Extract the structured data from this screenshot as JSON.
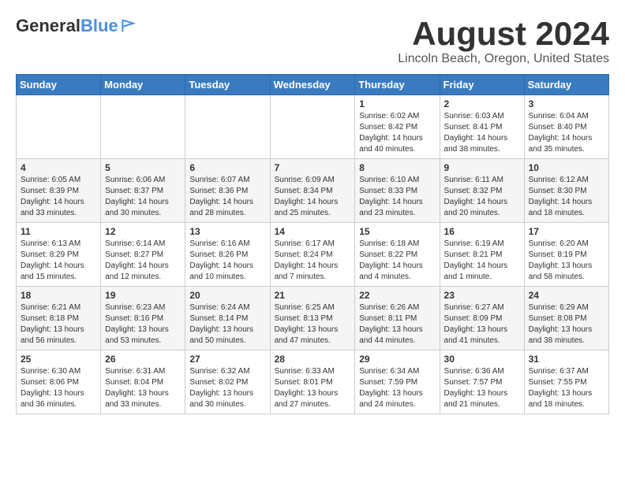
{
  "header": {
    "logo_general": "General",
    "logo_blue": "Blue",
    "title": "August 2024",
    "subtitle": "Lincoln Beach, Oregon, United States"
  },
  "weekdays": [
    "Sunday",
    "Monday",
    "Tuesday",
    "Wednesday",
    "Thursday",
    "Friday",
    "Saturday"
  ],
  "weeks": [
    {
      "days": [
        {
          "num": "",
          "info": ""
        },
        {
          "num": "",
          "info": ""
        },
        {
          "num": "",
          "info": ""
        },
        {
          "num": "",
          "info": ""
        },
        {
          "num": "1",
          "info": "Sunrise: 6:02 AM\nSunset: 8:42 PM\nDaylight: 14 hours\nand 40 minutes."
        },
        {
          "num": "2",
          "info": "Sunrise: 6:03 AM\nSunset: 8:41 PM\nDaylight: 14 hours\nand 38 minutes."
        },
        {
          "num": "3",
          "info": "Sunrise: 6:04 AM\nSunset: 8:40 PM\nDaylight: 14 hours\nand 35 minutes."
        }
      ]
    },
    {
      "days": [
        {
          "num": "4",
          "info": "Sunrise: 6:05 AM\nSunset: 8:39 PM\nDaylight: 14 hours\nand 33 minutes."
        },
        {
          "num": "5",
          "info": "Sunrise: 6:06 AM\nSunset: 8:37 PM\nDaylight: 14 hours\nand 30 minutes."
        },
        {
          "num": "6",
          "info": "Sunrise: 6:07 AM\nSunset: 8:36 PM\nDaylight: 14 hours\nand 28 minutes."
        },
        {
          "num": "7",
          "info": "Sunrise: 6:09 AM\nSunset: 8:34 PM\nDaylight: 14 hours\nand 25 minutes."
        },
        {
          "num": "8",
          "info": "Sunrise: 6:10 AM\nSunset: 8:33 PM\nDaylight: 14 hours\nand 23 minutes."
        },
        {
          "num": "9",
          "info": "Sunrise: 6:11 AM\nSunset: 8:32 PM\nDaylight: 14 hours\nand 20 minutes."
        },
        {
          "num": "10",
          "info": "Sunrise: 6:12 AM\nSunset: 8:30 PM\nDaylight: 14 hours\nand 18 minutes."
        }
      ]
    },
    {
      "days": [
        {
          "num": "11",
          "info": "Sunrise: 6:13 AM\nSunset: 8:29 PM\nDaylight: 14 hours\nand 15 minutes."
        },
        {
          "num": "12",
          "info": "Sunrise: 6:14 AM\nSunset: 8:27 PM\nDaylight: 14 hours\nand 12 minutes."
        },
        {
          "num": "13",
          "info": "Sunrise: 6:16 AM\nSunset: 8:26 PM\nDaylight: 14 hours\nand 10 minutes."
        },
        {
          "num": "14",
          "info": "Sunrise: 6:17 AM\nSunset: 8:24 PM\nDaylight: 14 hours\nand 7 minutes."
        },
        {
          "num": "15",
          "info": "Sunrise: 6:18 AM\nSunset: 8:22 PM\nDaylight: 14 hours\nand 4 minutes."
        },
        {
          "num": "16",
          "info": "Sunrise: 6:19 AM\nSunset: 8:21 PM\nDaylight: 14 hours\nand 1 minute."
        },
        {
          "num": "17",
          "info": "Sunrise: 6:20 AM\nSunset: 8:19 PM\nDaylight: 13 hours\nand 58 minutes."
        }
      ]
    },
    {
      "days": [
        {
          "num": "18",
          "info": "Sunrise: 6:21 AM\nSunset: 8:18 PM\nDaylight: 13 hours\nand 56 minutes."
        },
        {
          "num": "19",
          "info": "Sunrise: 6:23 AM\nSunset: 8:16 PM\nDaylight: 13 hours\nand 53 minutes."
        },
        {
          "num": "20",
          "info": "Sunrise: 6:24 AM\nSunset: 8:14 PM\nDaylight: 13 hours\nand 50 minutes."
        },
        {
          "num": "21",
          "info": "Sunrise: 6:25 AM\nSunset: 8:13 PM\nDaylight: 13 hours\nand 47 minutes."
        },
        {
          "num": "22",
          "info": "Sunrise: 6:26 AM\nSunset: 8:11 PM\nDaylight: 13 hours\nand 44 minutes."
        },
        {
          "num": "23",
          "info": "Sunrise: 6:27 AM\nSunset: 8:09 PM\nDaylight: 13 hours\nand 41 minutes."
        },
        {
          "num": "24",
          "info": "Sunrise: 6:29 AM\nSunset: 8:08 PM\nDaylight: 13 hours\nand 38 minutes."
        }
      ]
    },
    {
      "days": [
        {
          "num": "25",
          "info": "Sunrise: 6:30 AM\nSunset: 8:06 PM\nDaylight: 13 hours\nand 36 minutes."
        },
        {
          "num": "26",
          "info": "Sunrise: 6:31 AM\nSunset: 8:04 PM\nDaylight: 13 hours\nand 33 minutes."
        },
        {
          "num": "27",
          "info": "Sunrise: 6:32 AM\nSunset: 8:02 PM\nDaylight: 13 hours\nand 30 minutes."
        },
        {
          "num": "28",
          "info": "Sunrise: 6:33 AM\nSunset: 8:01 PM\nDaylight: 13 hours\nand 27 minutes."
        },
        {
          "num": "29",
          "info": "Sunrise: 6:34 AM\nSunset: 7:59 PM\nDaylight: 13 hours\nand 24 minutes."
        },
        {
          "num": "30",
          "info": "Sunrise: 6:36 AM\nSunset: 7:57 PM\nDaylight: 13 hours\nand 21 minutes."
        },
        {
          "num": "31",
          "info": "Sunrise: 6:37 AM\nSunset: 7:55 PM\nDaylight: 13 hours\nand 18 minutes."
        }
      ]
    }
  ]
}
